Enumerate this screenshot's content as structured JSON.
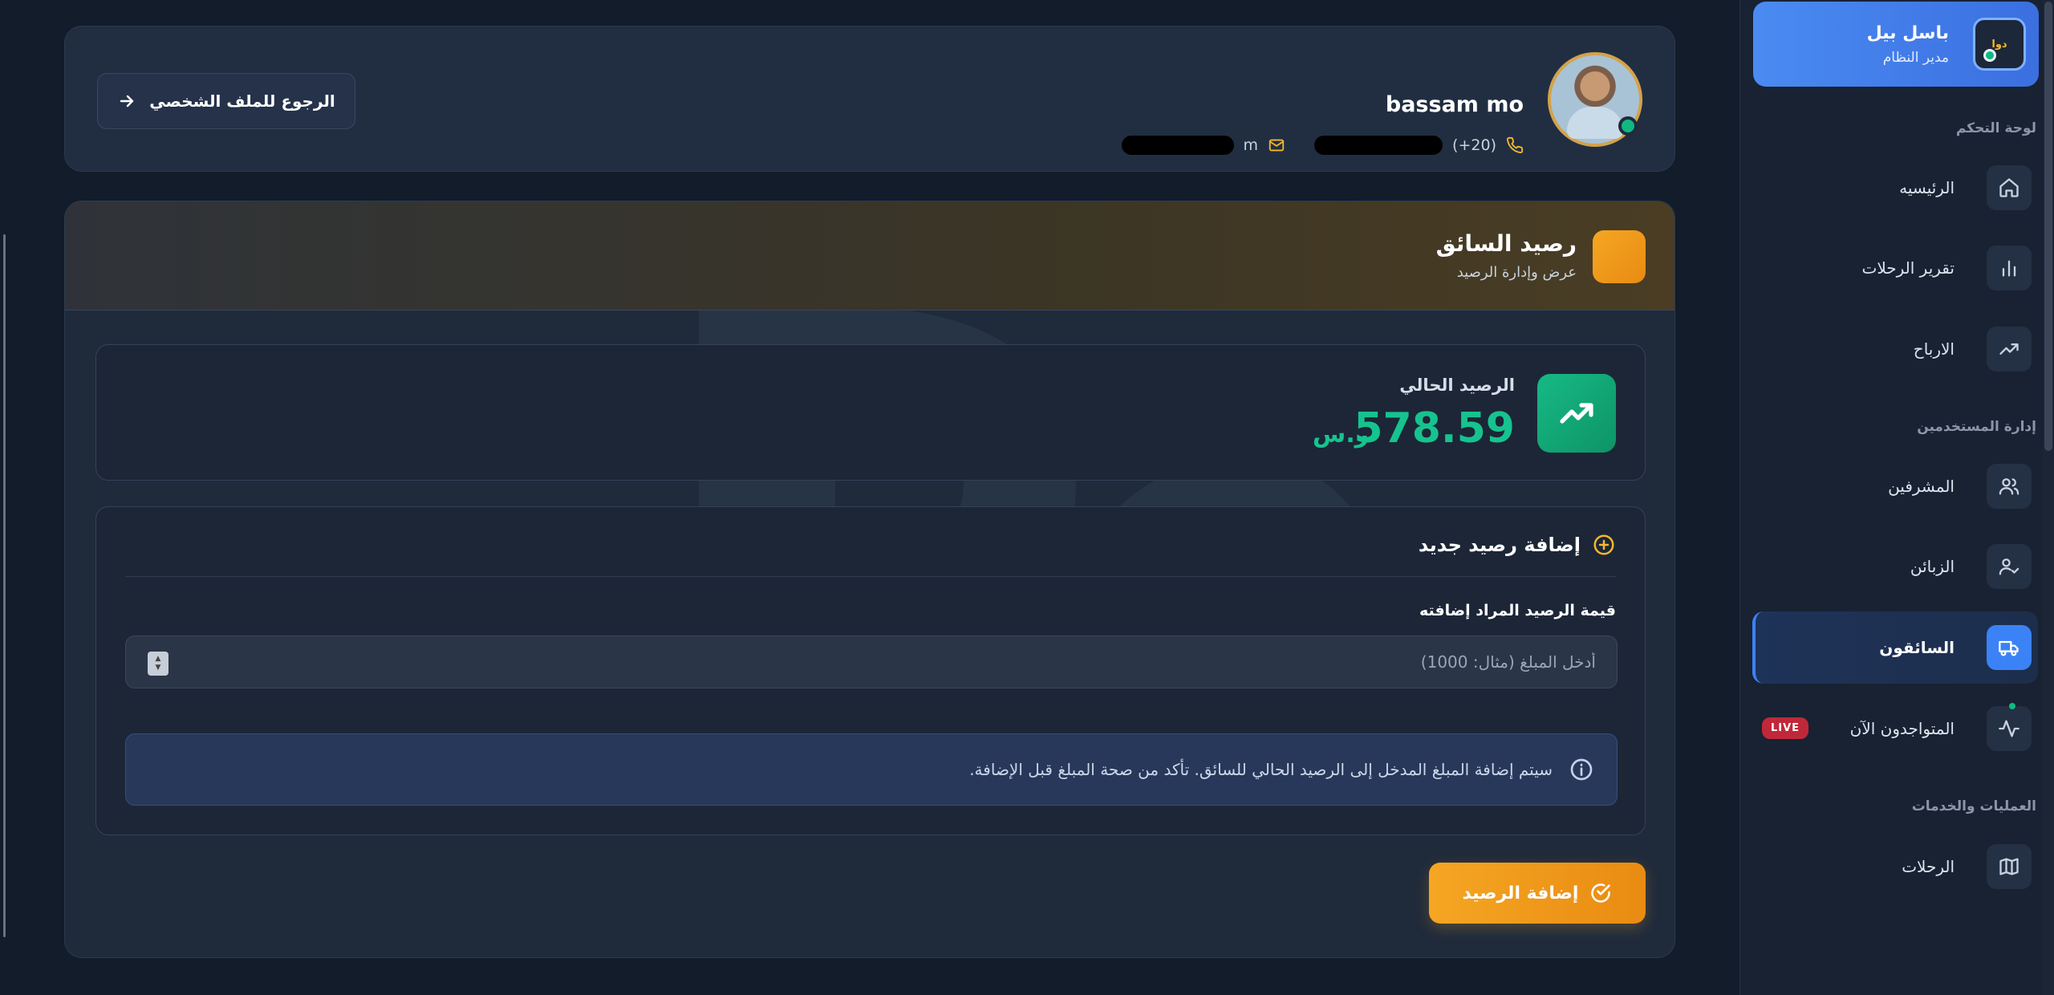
{
  "sidebar": {
    "user": {
      "name": "باسل بيل",
      "role": "مدير النظام",
      "logo_text": "دوا"
    },
    "sections": [
      {
        "title": "لوحة التحكم"
      },
      {
        "title": "إدارة المستخدمين"
      },
      {
        "title": "العمليات والخدمات"
      }
    ],
    "items": [
      {
        "label": "الرئيسيه",
        "icon": "home-icon"
      },
      {
        "label": "تقرير الرحلات",
        "icon": "bar-chart-icon"
      },
      {
        "label": "الارباح",
        "icon": "trending-up-icon"
      },
      {
        "label": "المشرفين",
        "icon": "users-icon"
      },
      {
        "label": "الزبائن",
        "icon": "user-check-icon"
      },
      {
        "label": "السائقون",
        "icon": "truck-icon",
        "active": true
      },
      {
        "label": "المتواجدون الآن",
        "icon": "activity-icon",
        "badge": "LIVE"
      },
      {
        "label": "الرحلات",
        "icon": "map-icon"
      }
    ]
  },
  "profile": {
    "name": "bassam mo",
    "email_visible": "m",
    "phone_visible": "(20+)",
    "back_button": "الرجوع للملف الشخصي"
  },
  "balance": {
    "title": "رصيد السائق",
    "subtitle": "عرض وإدارة الرصيد",
    "current_label": "الرصيد الحالي",
    "current_value": "578.59",
    "currency": "ر.س"
  },
  "add_balance": {
    "title": "إضافة رصيد جديد",
    "field_label": "قيمة الرصيد المراد إضافته",
    "placeholder": "أدخل المبلغ (مثال: 1000)",
    "value": "",
    "info": "سيتم إضافة المبلغ المدخل إلى الرصيد الحالي للسائق. تأكد من صحة المبلغ قبل الإضافة.",
    "submit": "إضافة الرصيد"
  },
  "colors": {
    "accent_orange": "#f5a623",
    "accent_green": "#16c38e",
    "accent_blue": "#3b82f6",
    "live_red": "#c0283a"
  }
}
